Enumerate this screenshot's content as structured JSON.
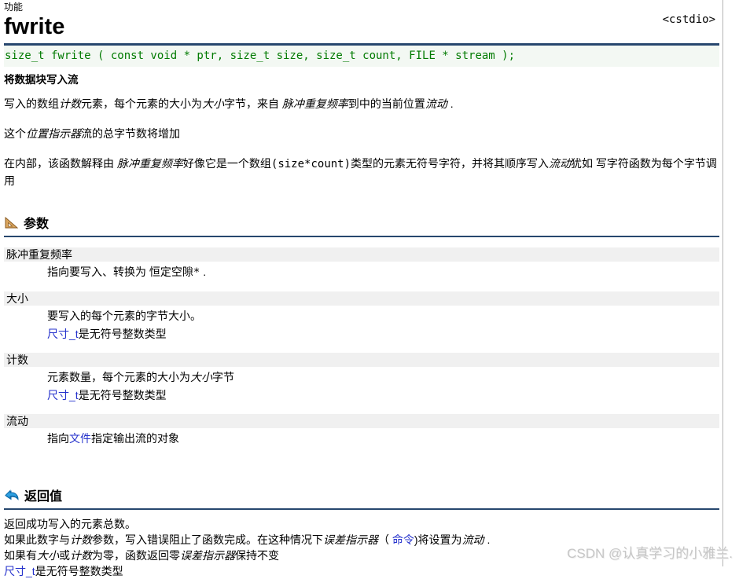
{
  "header": {
    "category_label": "功能",
    "title": "fwrite",
    "include_ref": "<cstdio>",
    "prototype": "size_t fwrite ( const void * ptr, size_t size, size_t count, FILE * stream );",
    "summary": "将数据块写入流"
  },
  "intro": [
    [
      {
        "t": "写入的数组"
      },
      {
        "t": "计数",
        "s": "i"
      },
      {
        "t": "元素，每个元素的大小为"
      },
      {
        "t": "大小",
        "s": "i"
      },
      {
        "t": "字节，来自 "
      },
      {
        "t": "脉冲重复频率",
        "s": "i"
      },
      {
        "t": "到中的当前位置"
      },
      {
        "t": "流动",
        "s": "i"
      },
      {
        "t": " ."
      }
    ],
    [
      {
        "t": "这个"
      },
      {
        "t": "位置指示器",
        "s": "i"
      },
      {
        "t": "流的总字节数将增加"
      }
    ],
    [
      {
        "t": "在内部，该函数解释由 "
      },
      {
        "t": "脉冲重复频率",
        "s": "i"
      },
      {
        "t": "好像它是一个数组"
      },
      {
        "t": "(size*count)",
        "s": "m"
      },
      {
        "t": "类型的元素无符号字符，并将其顺序写入"
      },
      {
        "t": "流动",
        "s": "i"
      },
      {
        "t": "犹如 写字符函数为每个字节调用"
      }
    ]
  ],
  "sections": {
    "parameters": {
      "title": "参数",
      "icon": "set-square-icon",
      "items": [
        {
          "term": "脉冲重复频率",
          "lines": [
            [
              {
                "t": "指向要写入、转换为 "
              },
              {
                "t": "恒定空隙*",
                "s": "m"
              },
              {
                "t": " ."
              }
            ]
          ]
        },
        {
          "term": "大小",
          "lines": [
            [
              {
                "t": "要写入的每个元素的字节大小。"
              }
            ],
            [
              {
                "t": "尺寸_t",
                "s": "a"
              },
              {
                "t": "是无符号整数类型"
              }
            ]
          ]
        },
        {
          "term": "计数",
          "lines": [
            [
              {
                "t": "元素数量，每个元素的大小为"
              },
              {
                "t": "大小",
                "s": "i"
              },
              {
                "t": "字节"
              }
            ],
            [
              {
                "t": "尺寸_t",
                "s": "a"
              },
              {
                "t": "是无符号整数类型"
              }
            ]
          ]
        },
        {
          "term": "流动",
          "lines": [
            [
              {
                "t": "指向"
              },
              {
                "t": "文件",
                "s": "a"
              },
              {
                "t": "指定输出流的对象"
              }
            ]
          ]
        }
      ]
    },
    "return_value": {
      "title": "返回值",
      "icon": "return-arrow-icon",
      "lines": [
        [
          {
            "t": "返回成功写入的元素总数。"
          }
        ],
        [
          {
            "t": "如果此数字与"
          },
          {
            "t": "计数",
            "s": "i"
          },
          {
            "t": "参数，写入错误阻止了函数完成。在这种情况下"
          },
          {
            "t": "误差指示器",
            "s": "i"
          },
          {
            "t": "（ "
          },
          {
            "t": "命令",
            "s": "a"
          },
          {
            "t": ")将设置为"
          },
          {
            "t": "流动",
            "s": "i"
          },
          {
            "t": " ."
          }
        ],
        [
          {
            "t": "如果有"
          },
          {
            "t": "大小",
            "s": "i"
          },
          {
            "t": "或"
          },
          {
            "t": "计数",
            "s": "i"
          },
          {
            "t": "为零，函数返回零"
          },
          {
            "t": "误差指示器",
            "s": "i"
          },
          {
            "t": "保持不变"
          }
        ],
        [
          {
            "t": "尺寸_t",
            "s": "a"
          },
          {
            "t": "是无符号整数类型"
          }
        ]
      ]
    }
  },
  "watermark": "CSDN @认真学习的小雅兰."
}
